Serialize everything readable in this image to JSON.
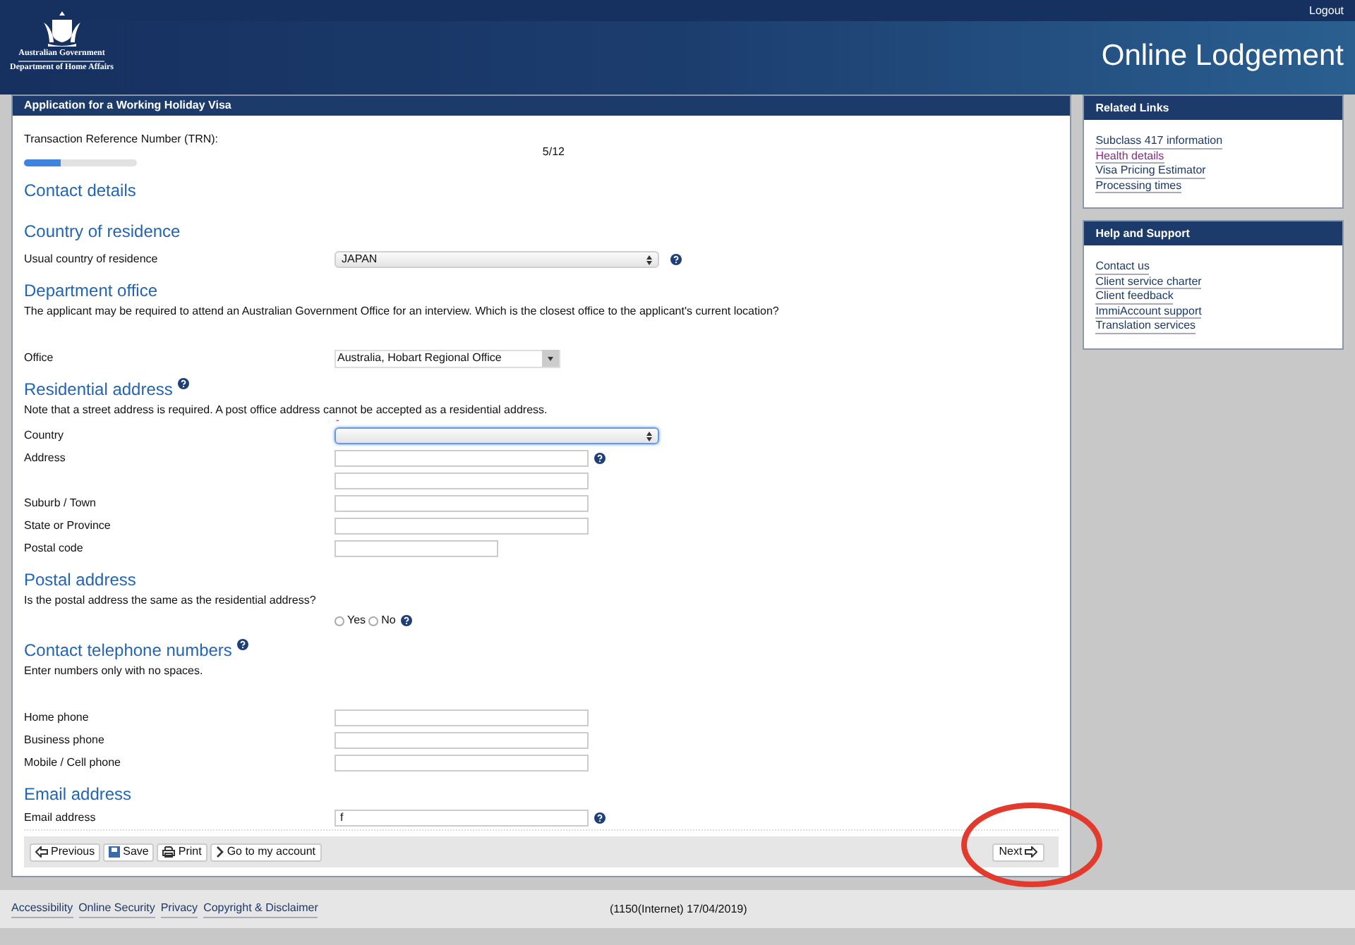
{
  "header": {
    "logout": "Logout",
    "logo_lines": [
      "Australian Government",
      "Department of Home Affairs"
    ],
    "title": "Online Lodgement"
  },
  "form": {
    "title": "Application for a Working Holiday Visa",
    "trn_label": "Transaction Reference Number (TRN):",
    "progress": {
      "level": 0.33,
      "reading": "5/12"
    },
    "items": [
      {
        "kind": "title",
        "text": "Contact details"
      },
      {
        "kind": "heading",
        "text": "Country of residence",
        "help": false
      },
      {
        "kind": "select",
        "label": "Usual country of residence",
        "value": "JAPAN",
        "help": true,
        "focused": false
      },
      {
        "kind": "heading",
        "text": "Department office",
        "help": false
      },
      {
        "kind": "note",
        "text": "The applicant may be required to attend an Australian Government Office for an interview. Which is the closest office to the applicant's current location?",
        "spaced": true
      },
      {
        "kind": "combo",
        "label": "Office",
        "value": "Australia, Hobart Regional Office"
      },
      {
        "kind": "heading",
        "text": "Residential address",
        "help": true
      },
      {
        "kind": "note",
        "text": "Note that a street address is required. A post office address cannot be accepted as a residential address.",
        "spaced": false
      },
      {
        "kind": "select",
        "label": "Country",
        "value": "",
        "help": false,
        "focused": true,
        "mark": "-"
      },
      {
        "kind": "input",
        "label": "Address",
        "value": "",
        "help": true,
        "short": false
      },
      {
        "kind": "input",
        "value": "",
        "help": false,
        "short": false
      },
      {
        "kind": "input",
        "label": "Suburb / Town",
        "value": "",
        "help": false,
        "short": false
      },
      {
        "kind": "input",
        "label": "State or Province",
        "value": "",
        "help": false,
        "short": false
      },
      {
        "kind": "input",
        "label": "Postal code",
        "value": "",
        "help": false,
        "short": true
      },
      {
        "kind": "heading",
        "text": "Postal address",
        "help": false
      },
      {
        "kind": "note",
        "text": "Is the postal address the same as the residential address?",
        "spaced": false
      },
      {
        "kind": "radio",
        "options": [
          {
            "label": "Yes",
            "selected": false
          },
          {
            "label": "No",
            "selected": false
          }
        ],
        "help": true
      },
      {
        "kind": "heading",
        "text": "Contact telephone numbers",
        "help": true
      },
      {
        "kind": "note",
        "text": "Enter numbers only with no spaces.",
        "spaced": true
      },
      {
        "kind": "input",
        "label": "Home phone",
        "value": "",
        "help": false,
        "short": false
      },
      {
        "kind": "input",
        "label": "Business phone",
        "value": "",
        "help": false,
        "short": false
      },
      {
        "kind": "input",
        "label": "Mobile / Cell phone",
        "value": "",
        "help": false,
        "short": false
      },
      {
        "kind": "heading",
        "text": "Email address",
        "help": false
      },
      {
        "kind": "input",
        "label": "Email address",
        "value": "f",
        "help": true,
        "short": false
      }
    ],
    "toolbar": [
      {
        "label": "Previous"
      },
      {
        "label": "Save"
      },
      {
        "label": "Print"
      },
      {
        "label": "Go to my account"
      }
    ],
    "next": "Next"
  },
  "sidebar": [
    {
      "title": "Related Links",
      "links": [
        {
          "label": "Subclass 417 information",
          "visited": false
        },
        {
          "label": "Health details",
          "visited": true
        },
        {
          "label": "Visa Pricing Estimator",
          "visited": false
        },
        {
          "label": "Processing times",
          "visited": false
        }
      ]
    },
    {
      "title": "Help and Support",
      "links": [
        {
          "label": "Contact us",
          "visited": false
        },
        {
          "label": "Client service charter",
          "visited": false
        },
        {
          "label": "Client feedback",
          "visited": false
        },
        {
          "label": "ImmiAccount support",
          "visited": false
        },
        {
          "label": "Translation services",
          "visited": false
        }
      ]
    }
  ],
  "footer": {
    "links": [
      "Accessibility",
      "Online Security",
      "Privacy",
      "Copyright & Disclaimer"
    ],
    "info": "(1150(Internet) 17/04/2019)"
  },
  "annotation": {
    "kind": "circle"
  }
}
